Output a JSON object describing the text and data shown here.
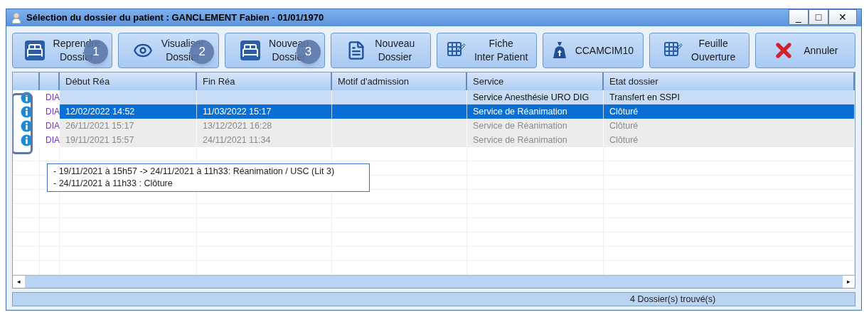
{
  "window": {
    "title": "Sélection du dossier du patient : GANCLEMENT Fabien - 01/01/1970",
    "controls": [
      "_",
      "□",
      "✕"
    ]
  },
  "toolbar": [
    {
      "label": "Reprendre\nDossier",
      "kind": "resume",
      "badge": "1"
    },
    {
      "label": "Visualiser\nDossier",
      "kind": "view",
      "badge": "2"
    },
    {
      "label": "Nouveau\nDossier",
      "kind": "admit",
      "badge": "3"
    },
    {
      "label": "Nouveau\nDossier",
      "kind": "new"
    },
    {
      "label": "Fiche\nInter Patient",
      "kind": "sheet"
    },
    {
      "label": "CCAMCIM10",
      "kind": "coding"
    },
    {
      "label": "Feuille\nOuverture",
      "kind": "sheet"
    },
    {
      "label": "Annuler",
      "kind": "cancel"
    }
  ],
  "table": {
    "columns": [
      "",
      "",
      "Début Réa",
      "Fin Réa",
      "Motif d'admission",
      "Service",
      "Etat dossier"
    ],
    "rows": [
      {
        "type": "DIA",
        "debut": "",
        "fin": "",
        "motif": "",
        "service": "Service Anesthésie URO DIG",
        "etat": "Transfert en SSPI",
        "selected": false,
        "highlighted": true,
        "disabled": false
      },
      {
        "type": "DIA",
        "debut": "12/02/2022 14:52",
        "fin": "11/03/2022 15:17",
        "motif": "",
        "service": "Service de Réanimation",
        "etat": "Clôturé",
        "selected": true,
        "highlighted": false,
        "disabled": false
      },
      {
        "type": "DIA",
        "debut": "26/11/2021 15:17",
        "fin": "13/12/2021 16:28",
        "motif": "",
        "service": "Service de Réanimation",
        "etat": "Clôturé",
        "selected": false,
        "highlighted": false,
        "disabled": true
      },
      {
        "type": "DIA",
        "debut": "19/11/2021 15:57",
        "fin": "24/11/2021 11:34",
        "motif": "",
        "service": "Service de Réanimation",
        "etat": "Clôturé",
        "selected": false,
        "highlighted": false,
        "disabled": true
      }
    ],
    "tooltip": [
      "- 19/11/2021 à 15h57 -> 24/11/2021 à 11h33: Réanimation / USC (Lit 3)",
      "- 24/11/2021 à 11h33 : Clôture"
    ]
  },
  "scrollbar": {
    "left": "◂",
    "right": "▸"
  },
  "status_bar": "4 Dossier(s) trouvé(s)"
}
